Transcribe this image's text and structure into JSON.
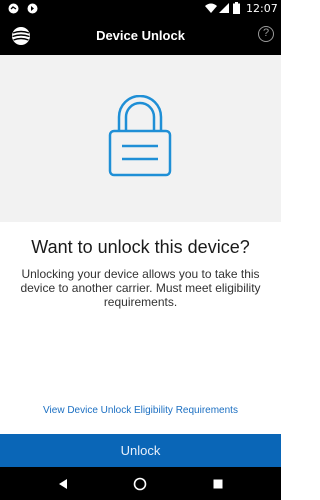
{
  "status_bar": {
    "time": "12:07",
    "icons": [
      "notification-icon",
      "notification-icon-2",
      "wifi-icon",
      "signal-icon",
      "battery-icon"
    ]
  },
  "app_bar": {
    "logo_icon": "att-logo-icon",
    "title": "Device Unlock",
    "help_label": "?"
  },
  "hero": {
    "icon": "lock-icon",
    "accent_color": "#1f8fd6",
    "background": "#f2f2f2"
  },
  "content": {
    "heading": "Want to unlock this device?",
    "description": "Unlocking your device allows you to take this device to another carrier. Must meet eligibility requirements.",
    "link": "View Device Unlock Eligibility Requirements"
  },
  "actions": {
    "unlock_label": "Unlock",
    "button_color": "#0a66b7"
  },
  "nav_bar": {
    "icons": [
      "back-icon",
      "home-icon",
      "recents-icon"
    ]
  }
}
